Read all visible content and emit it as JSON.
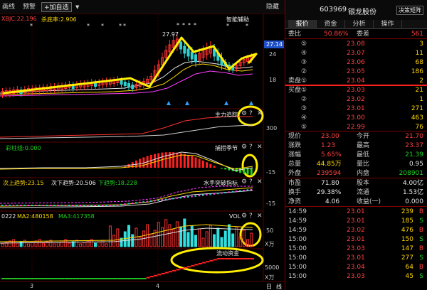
{
  "toolbar": {
    "items": [
      "画线",
      "预警"
    ],
    "add_button": "+加自选",
    "dropdown": "▼",
    "hide_label": "隐藏"
  },
  "main_chart": {
    "indicator_name": "XBJC",
    "indicator_value": "22.196",
    "indicator2_name": "杀底率",
    "indicator2_value": "2.906",
    "aux_label": "智能辅助",
    "high_label": "27.97",
    "price_tag": "27.14",
    "yticks": [
      "24",
      "18"
    ],
    "stars": [
      "*",
      "*",
      "*",
      "*",
      "*",
      "*",
      "*",
      "*",
      "*",
      "*",
      "*",
      "*",
      "*",
      "*"
    ]
  },
  "panel_main_force": {
    "name": "主力追踪",
    "ytick": "300"
  },
  "panel_caifeng": {
    "name": "彩柱线",
    "value": "0.000",
    "name2": "捕捞季节",
    "yticks": [
      "-15"
    ]
  },
  "panel_trend": {
    "items": [
      {
        "label": "次上趋势",
        "value": "23.15"
      },
      {
        "label": "次下趋势",
        "value": "20.506"
      },
      {
        "label": "下趋势",
        "value": "18.228"
      }
    ],
    "name": "水手突破指标",
    "yticks": [
      "-15"
    ]
  },
  "panel_vol": {
    "left_code": "0222",
    "ma2_label": "MA2",
    "ma2_value": "480158",
    "ma3_label": "MA3",
    "ma3_value": "417358",
    "name": "VOL",
    "yticks": [
      "50"
    ],
    "unit": "X万"
  },
  "panel_capital": {
    "name": "流动资金",
    "ytick": "5000",
    "unit": "X万"
  },
  "xaxis": {
    "labels": [
      "3",
      "4"
    ],
    "right": [
      "日",
      "线"
    ]
  },
  "quote": {
    "code": "603969",
    "name": "银龙股份",
    "decision_btn": "决策矩阵",
    "tabs": [
      "报价",
      "资金",
      "分析",
      "操作"
    ],
    "weibi_label": "委比",
    "weibi_value": "50.86%",
    "weicha_label": "委差",
    "weicha_value": "561",
    "sell": [
      {
        "label": "⑤",
        "price": "23.08",
        "vol": "3"
      },
      {
        "label": "④",
        "price": "23.07",
        "vol": "11"
      },
      {
        "label": "③",
        "price": "23.06",
        "vol": "68"
      },
      {
        "label": "②",
        "price": "23.05",
        "vol": "186"
      },
      {
        "label": "卖盘①",
        "price": "23.04",
        "vol": "2"
      }
    ],
    "buy": [
      {
        "label": "买盘①",
        "price": "23.03",
        "vol": "21"
      },
      {
        "label": "②",
        "price": "23.02",
        "vol": "1"
      },
      {
        "label": "③",
        "price": "23.01",
        "vol": "271"
      },
      {
        "label": "④",
        "price": "23.00",
        "vol": "463"
      },
      {
        "label": "⑤",
        "price": "22.99",
        "vol": "76"
      }
    ],
    "stats": [
      {
        "l1": "现价",
        "v1": "23.00",
        "l2": "今开",
        "v2": "21.70",
        "c1": "r",
        "c2": "r"
      },
      {
        "l1": "涨跌",
        "v1": "1.23",
        "l2": "最高",
        "v2": "23.37",
        "c1": "r",
        "c2": "r"
      },
      {
        "l1": "涨幅",
        "v1": "5.65%",
        "l2": "最低",
        "v2": "21.39",
        "c1": "r",
        "c2": "g"
      },
      {
        "l1": "总量",
        "v1": "44.85万",
        "l2": "量比",
        "v2": "0.95",
        "c1": "y",
        "c2": "w"
      },
      {
        "l1": "外盘",
        "v1": "239594",
        "l2": "内盘",
        "v2": "208901",
        "c1": "r",
        "c2": "g"
      }
    ],
    "stats2": [
      {
        "l1": "市盈",
        "v1": "71.80",
        "l2": "股本",
        "v2": "4.00亿"
      },
      {
        "l1": "换手",
        "v1": "29.38%",
        "l2": "流通",
        "v2": "1.53亿"
      },
      {
        "l1": "净资",
        "v1": "4.06",
        "l2": "收益(一)",
        "v2": "0.000"
      }
    ],
    "ticks": [
      {
        "time": "14:59",
        "price": "23.01",
        "vol": "239",
        "dir": "B"
      },
      {
        "time": "14:59",
        "price": "23.01",
        "vol": "185",
        "dir": "S"
      },
      {
        "time": "14:59",
        "price": "23.02",
        "vol": "476",
        "dir": "B"
      },
      {
        "time": "15:00",
        "price": "23.01",
        "vol": "150",
        "dir": "S"
      },
      {
        "time": "15:00",
        "price": "23.03",
        "vol": "147",
        "dir": "B"
      },
      {
        "time": "15:00",
        "price": "23.01",
        "vol": "277",
        "dir": "S"
      },
      {
        "time": "15:00",
        "price": "23.04",
        "vol": "64",
        "dir": "B"
      },
      {
        "time": "15:00",
        "price": "23.03",
        "vol": "45",
        "dir": "S"
      }
    ]
  }
}
